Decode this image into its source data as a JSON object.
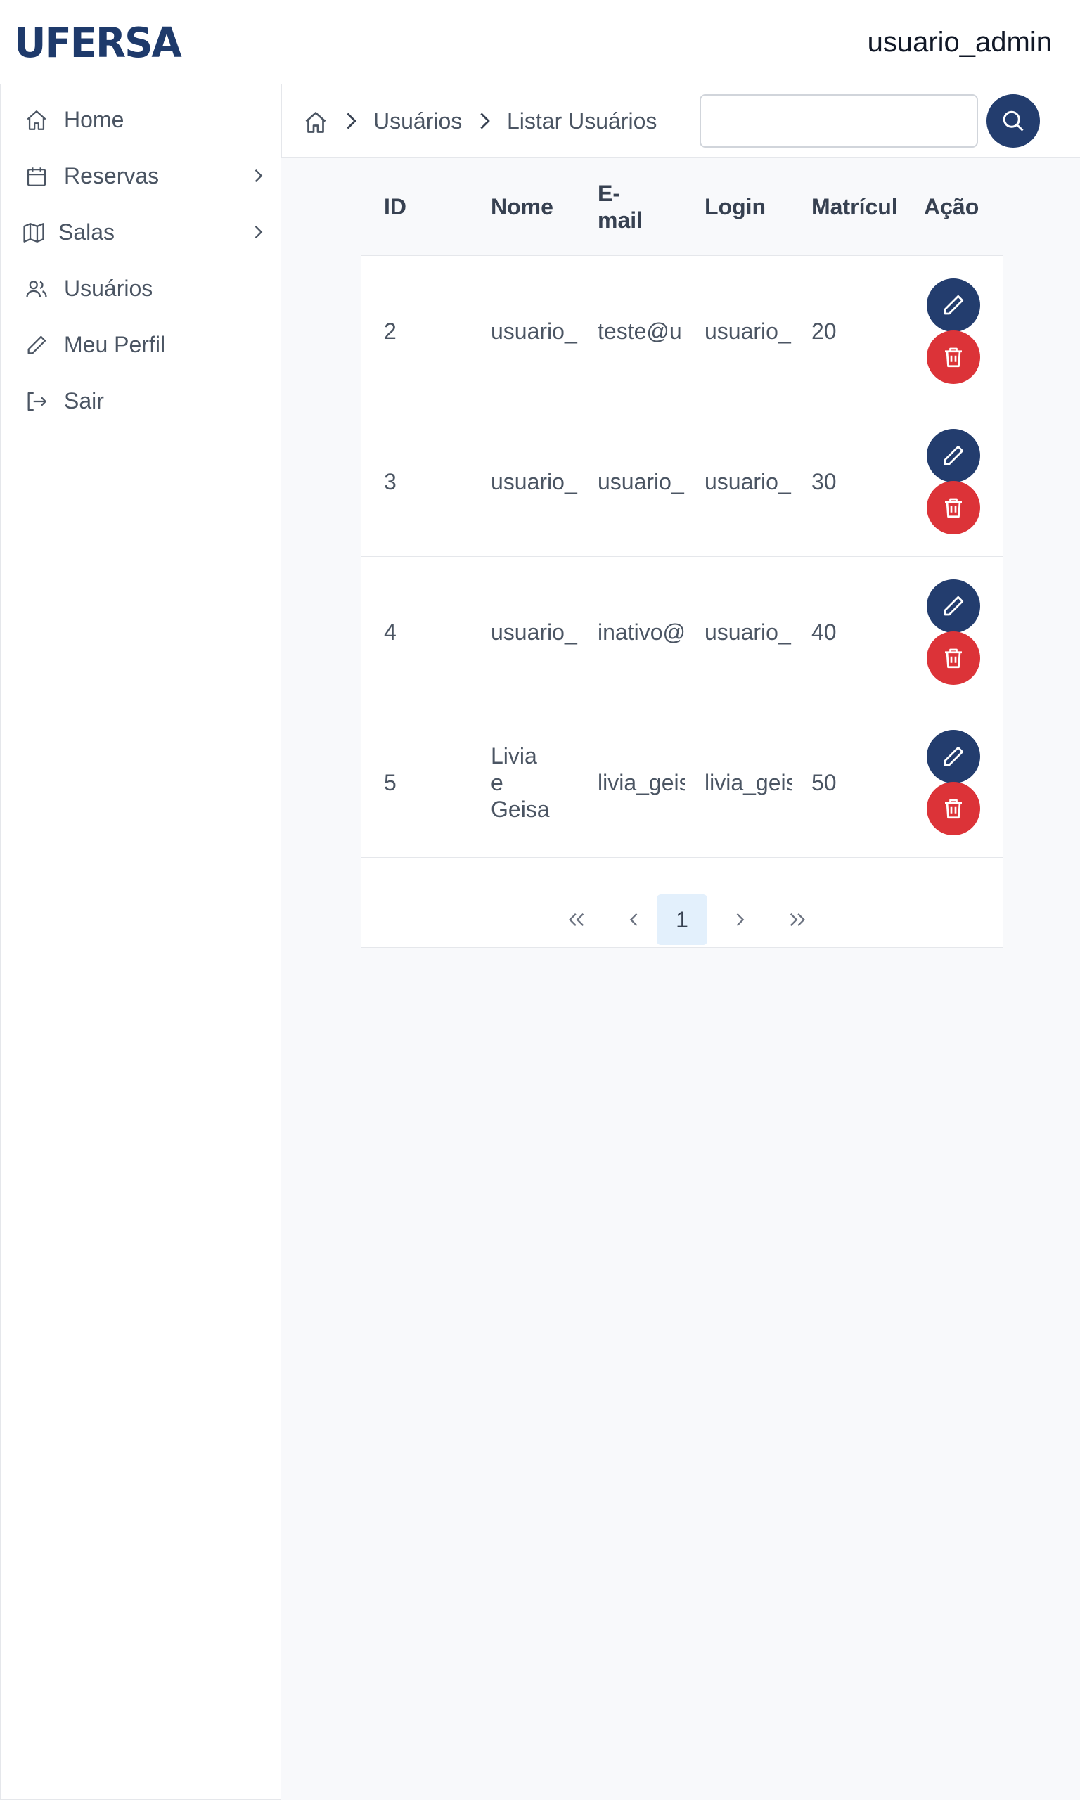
{
  "header": {
    "logo_text": "UFERSA",
    "username": "usuario_admin"
  },
  "sidebar": {
    "items": [
      {
        "label": "Home",
        "icon": "home-icon"
      },
      {
        "label": "Reservas",
        "icon": "calendar-icon",
        "has_submenu": true
      },
      {
        "label": "Salas",
        "icon": "map-icon",
        "has_submenu": true
      },
      {
        "label": "Usuários",
        "icon": "users-icon"
      },
      {
        "label": "Meu Perfil",
        "icon": "pencil-icon"
      },
      {
        "label": "Sair",
        "icon": "logout-icon"
      }
    ]
  },
  "breadcrumb": {
    "home_icon": "home-icon",
    "items": [
      "Usuários",
      "Listar Usuários"
    ]
  },
  "search": {
    "placeholder": "",
    "value": "",
    "button_icon": "search-icon"
  },
  "table": {
    "columns": [
      "ID",
      "Nome",
      "E-\nmail",
      "Login",
      "Matrícul",
      "Ação"
    ],
    "rows": [
      {
        "id": "2",
        "nome": "usuario_",
        "email": "teste@u",
        "login": "usuario_",
        "matricula": "20"
      },
      {
        "id": "3",
        "nome": "usuario_",
        "email": "usuario_",
        "login": "usuario_",
        "matricula": "30"
      },
      {
        "id": "4",
        "nome": "usuario_",
        "email": "inativo@",
        "login": "usuario_",
        "matricula": "40"
      },
      {
        "id": "5",
        "nome": "Livia\ne\nGeisa",
        "email": "livia_geis",
        "login": "livia_geis",
        "matricula": "50"
      }
    ],
    "action_icons": [
      "pencil-icon",
      "trash-icon"
    ]
  },
  "pagination": {
    "current_page": "1",
    "controls": [
      "first-page",
      "previous-page",
      "next-page",
      "last-page"
    ]
  },
  "colors": {
    "brand": "#1e3a6b",
    "primary_button": "#233d6e",
    "danger_button": "#dc3338",
    "active_page_bg": "#e3f0fc"
  }
}
